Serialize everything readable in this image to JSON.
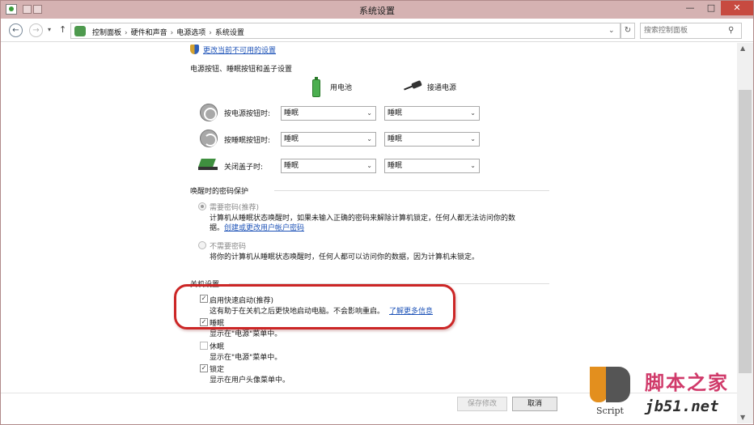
{
  "window": {
    "title": "系统设置",
    "min_glyph": "—",
    "max_glyph": "□",
    "close_glyph": "✕"
  },
  "address": {
    "back_glyph": "←",
    "forward_glyph": "→",
    "dropdown_glyph": "▾",
    "up_glyph": "↑",
    "crumbs": [
      "控制面板",
      "硬件和声音",
      "电源选项",
      "系统设置"
    ],
    "separator": "›",
    "chevron": "⌄",
    "refresh_glyph": "↻",
    "search_placeholder": "搜索控制面板",
    "search_glyph": "⚲"
  },
  "top_link": "更改当前不可用的设置",
  "power_section": {
    "title": "电源按钮、睡眠按钮和盖子设置",
    "col_battery": "用电池",
    "col_plugged": "接通电源",
    "rows": [
      {
        "label": "按电源按钮时:",
        "battery": "睡眠",
        "plugged": "睡眠"
      },
      {
        "label": "按睡眠按钮时:",
        "battery": "睡眠",
        "plugged": "睡眠"
      },
      {
        "label": "关闭盖子时:",
        "battery": "睡眠",
        "plugged": "睡眠"
      }
    ],
    "select_chevron": "⌄"
  },
  "password_section": {
    "title": "唤醒时的密码保护",
    "require_label": "需要密码(推荐)",
    "require_desc_1": "计算机从睡眠状态唤醒时，如果未输入正确的密码来解除计算机锁定，任何人都无法访问你的数",
    "require_desc_2": "据。",
    "require_link": "创建或更改用户帐户密码",
    "no_require_label": "不需要密码",
    "no_require_desc": "将你的计算机从睡眠状态唤醒时，任何人都可以访问你的数据，因为计算机未锁定。"
  },
  "shutdown_section": {
    "title": "关机设置",
    "check_glyph": "✓",
    "fast_startup_label": "启用快速启动(推荐)",
    "fast_startup_desc": "这有助于在关机之后更快地启动电脑。不会影响重启。",
    "fast_startup_link": "了解更多信息",
    "sleep_label": "睡眠",
    "sleep_desc": "显示在\"电源\"菜单中。",
    "hibernate_label": "休眠",
    "hibernate_desc": "显示在\"电源\"菜单中。",
    "lock_label": "锁定",
    "lock_desc": "显示在用户头像菜单中。"
  },
  "footer": {
    "save_label": "保存修改",
    "cancel_label": "取消"
  },
  "watermark": {
    "script_text": "Script",
    "site_cn": "脚本之家",
    "site_url": "jb51.net"
  },
  "scrollbar": {
    "up_glyph": "▲",
    "down_glyph": "▼"
  }
}
